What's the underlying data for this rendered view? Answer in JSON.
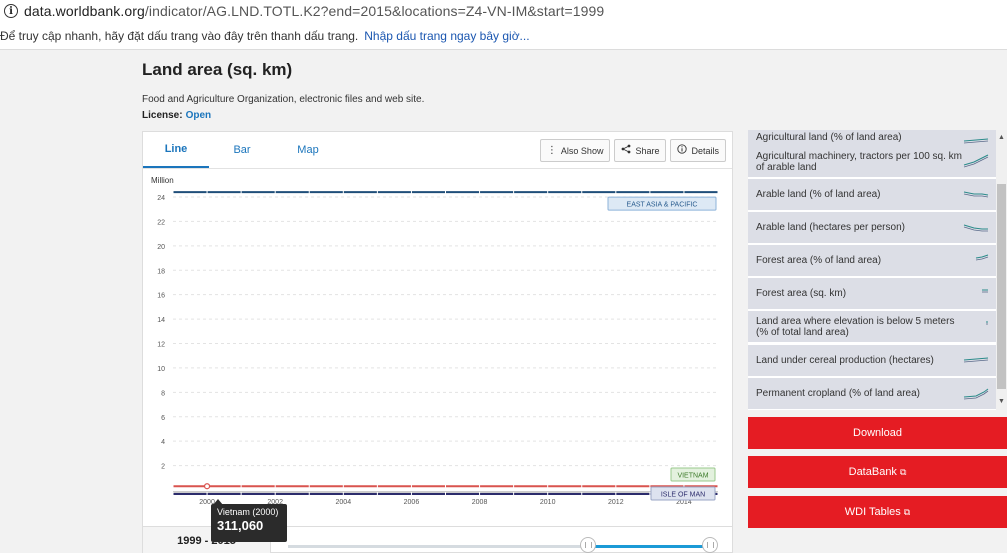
{
  "browser": {
    "url_host": "data.worldbank.org",
    "url_path": "/indicator/AG.LND.TOTL.K2?end=2015&locations=Z4-VN-IM&start=1999",
    "bookmark_message": "Để truy cập nhanh, hãy đặt dấu trang vào đây trên thanh dấu trang.",
    "bookmark_link": "Nhập dấu trang ngay bây giờ..."
  },
  "page": {
    "title": "Land area (sq. km)",
    "source": "Food and Agriculture Organization, electronic files and web site.",
    "license_label": "License:",
    "license_value": "Open"
  },
  "tabs": [
    {
      "label": "Line",
      "active": true
    },
    {
      "label": "Bar",
      "active": false
    },
    {
      "label": "Map",
      "active": false
    }
  ],
  "tools": {
    "also_show": "Also Show",
    "share": "Share",
    "details": "Details"
  },
  "chart_data": {
    "type": "line",
    "ylabel": "Million",
    "ylim": [
      0,
      24
    ],
    "yticks": [
      2,
      4,
      6,
      8,
      10,
      12,
      14,
      16,
      18,
      20,
      22,
      24
    ],
    "x": [
      1999,
      2000,
      2001,
      2002,
      2003,
      2004,
      2005,
      2006,
      2007,
      2008,
      2009,
      2010,
      2011,
      2012,
      2013,
      2014,
      2015
    ],
    "xticks": [
      2000,
      2002,
      2004,
      2006,
      2008,
      2010,
      2012,
      2014
    ],
    "xtick_labels": [
      "2000",
      "2002",
      "2004",
      "2006",
      "2008",
      "2010",
      "2012",
      "2014"
    ],
    "series": [
      {
        "name": "EAST ASIA & PACIFIC",
        "color": "#1f4e79",
        "values": [
          24.4,
          24.4,
          24.4,
          24.4,
          24.4,
          24.4,
          24.4,
          24.4,
          24.4,
          24.4,
          24.4,
          24.4,
          24.4,
          24.4,
          24.4,
          24.4,
          24.4
        ]
      },
      {
        "name": "VIETNAM",
        "color": "#d9534f",
        "values": [
          0.31,
          0.31,
          0.31,
          0.31,
          0.31,
          0.31,
          0.31,
          0.31,
          0.31,
          0.31,
          0.31,
          0.31,
          0.31,
          0.31,
          0.31,
          0.31,
          0.31
        ]
      },
      {
        "name": "ISLE OF MAN",
        "color": "#2c2c6c",
        "values": [
          0.0006,
          0.0006,
          0.0006,
          0.0006,
          0.0006,
          0.0006,
          0.0006,
          0.0006,
          0.0006,
          0.0006,
          0.0006,
          0.0006,
          0.0006,
          0.0006,
          0.0006,
          0.0006,
          0.0006
        ]
      }
    ],
    "grid": true
  },
  "tooltip": {
    "label": "Vietnam (2000)",
    "value": "311,060"
  },
  "range": {
    "label": "1999 - 2015"
  },
  "related": [
    {
      "label": "Agricultural land (% of land area)"
    },
    {
      "label": "Agricultural machinery, tractors per 100 sq. km of arable land"
    },
    {
      "label": "Arable land (% of land area)"
    },
    {
      "label": "Arable land (hectares per person)"
    },
    {
      "label": "Forest area (% of land area)"
    },
    {
      "label": "Forest area (sq. km)"
    },
    {
      "label": "Land area where elevation is below 5 meters (% of total land area)"
    },
    {
      "label": "Land under cereal production (hectares)"
    },
    {
      "label": "Permanent cropland (% of land area)"
    }
  ],
  "actions": {
    "download": "Download",
    "databank": "DataBank",
    "wdi_tables": "WDI Tables",
    "external_glyph": "⧉"
  },
  "colors": {
    "accent": "#1b75bc",
    "cta": "#e51c23"
  }
}
